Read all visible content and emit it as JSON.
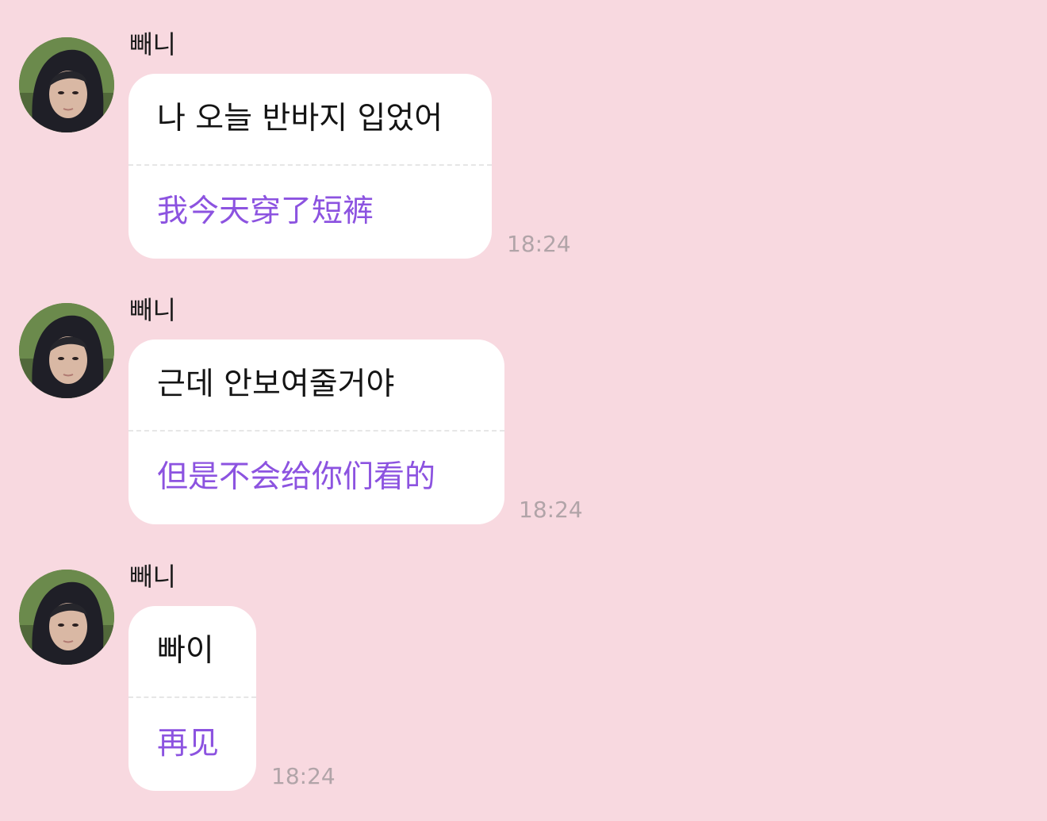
{
  "messages": [
    {
      "sender": "빼니",
      "original": "나 오늘 반바지 입었어",
      "translation": "我今天穿了短裤",
      "time": "18:24"
    },
    {
      "sender": "빼니",
      "original": "근데 안보여줄거야",
      "translation": "但是不会给你们看的",
      "time": "18:24"
    },
    {
      "sender": "빼니",
      "original": "빠이",
      "translation": "再见",
      "time": "18:24"
    }
  ],
  "colors": {
    "background": "#f8d9e0",
    "bubble": "#ffffff",
    "translation_text": "#8c53e0",
    "timestamp": "#b1a4a8"
  },
  "icons": {
    "avatar": "profile-photo"
  }
}
